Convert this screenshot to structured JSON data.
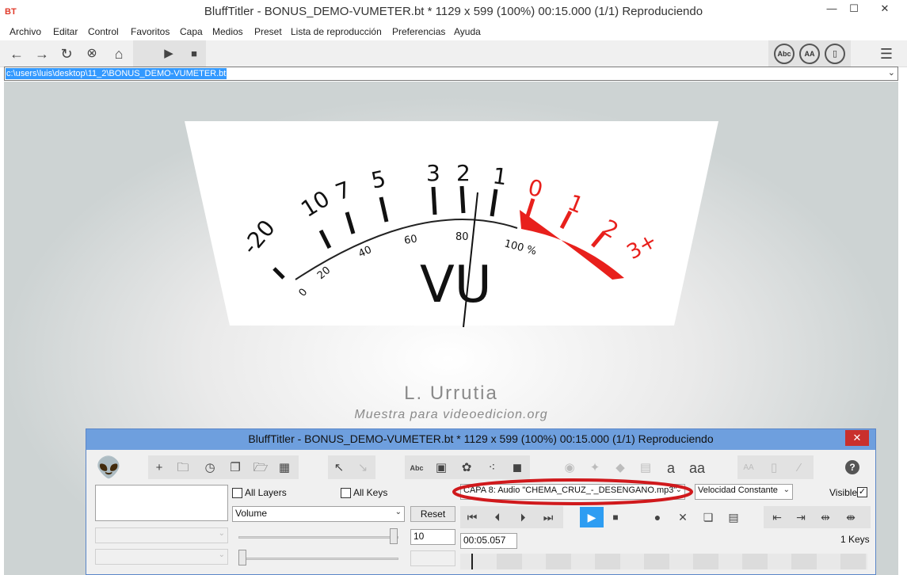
{
  "window": {
    "app_logo": "BT",
    "title": "BluffTitler - BONUS_DEMO-VUMETER.bt * 1129 x 599 (100%) 00:15.000 (1/1) Reproduciendo",
    "minimize": "—",
    "maximize": "☐",
    "close": "✕"
  },
  "menu": [
    "Archivo",
    "Editar",
    "Control",
    "Favoritos",
    "Capa",
    "Medios",
    "Preset",
    "Lista de reproducción",
    "Preferencias",
    "Ayuda"
  ],
  "toolbar": {
    "icons": [
      "back-icon",
      "forward-icon",
      "refresh-icon",
      "stop-load-icon",
      "home-icon",
      "play-icon",
      "stop-icon",
      "abc-icon",
      "aa-icon",
      "book-icon",
      "menu-icon"
    ],
    "abc_label": "Abc",
    "aa_label": "AA"
  },
  "address": {
    "path": "c:\\users\\luis\\desktop\\11_2\\BONUS_DEMO-VUMETER.bt"
  },
  "preview": {
    "meter": {
      "top_scale": [
        "-20",
        "10",
        "7",
        "5",
        "3",
        "2",
        "1",
        "0",
        "1",
        "2",
        "3+"
      ],
      "percent_scale": [
        "0",
        "20",
        "40",
        "60",
        "80",
        "100 %"
      ],
      "label": "VU",
      "red_color": "#e8201c"
    },
    "author": "L. Urrutia",
    "subtitle": "Muestra para videoedicion.org"
  },
  "panel": {
    "title": "BluffTitler - BONUS_DEMO-VUMETER.bt * 1129 x 599 (100%) 00:15.000 (1/1) Reproduciendo",
    "close": "✕",
    "abc_label": "Abc",
    "font_a": "a",
    "font_aa": "aa",
    "help": "?",
    "all_layers_label": "All Layers",
    "all_keys_label": "All Keys",
    "layer_select": "CAPA 8: Audio \"CHEMA_CRUZ_-_DESENGANO.mp3\"",
    "speed_select": "Velocidad Constante",
    "visible_label": "Visible",
    "visible_checked": "✓",
    "property_select": "Volume",
    "reset_label": "Reset",
    "value": "10",
    "time": "00:05.057",
    "keys_count": "1 Keys",
    "highlight_color": "#d0191c"
  }
}
